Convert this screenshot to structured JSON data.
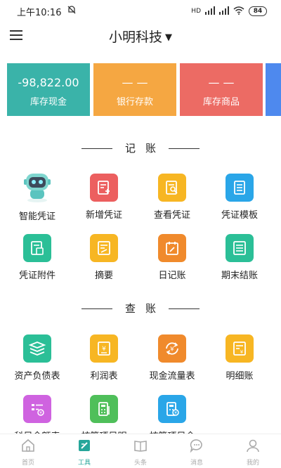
{
  "status": {
    "time": "上午10:16",
    "battery": "84",
    "network": "HD"
  },
  "header": {
    "company": "小明科技"
  },
  "cards": [
    {
      "value": "-98,822.00",
      "label": "库存现金"
    },
    {
      "value": "— —",
      "label": "银行存款"
    },
    {
      "value": "— —",
      "label": "库存商品"
    }
  ],
  "sections": {
    "bookkeeping": {
      "title": "记账",
      "items": [
        {
          "label": "智能凭证",
          "icon": "robot-icon"
        },
        {
          "label": "新增凭证",
          "icon": "add-voucher-icon"
        },
        {
          "label": "查看凭证",
          "icon": "view-voucher-icon"
        },
        {
          "label": "凭证模板",
          "icon": "voucher-template-icon"
        },
        {
          "label": "凭证附件",
          "icon": "attachment-icon"
        },
        {
          "label": "摘要",
          "icon": "summary-icon"
        },
        {
          "label": "日记账",
          "icon": "journal-icon"
        },
        {
          "label": "期末结账",
          "icon": "period-close-icon"
        }
      ]
    },
    "query": {
      "title": "查账",
      "items": [
        {
          "label": "资产负债表",
          "icon": "balance-sheet-icon"
        },
        {
          "label": "利润表",
          "icon": "income-statement-icon"
        },
        {
          "label": "现金流量表",
          "icon": "cash-flow-icon"
        },
        {
          "label": "明细账",
          "icon": "ledger-detail-icon"
        },
        {
          "label": "科目余额表",
          "icon": "account-balance-icon"
        },
        {
          "label": "核算项目明",
          "icon": "accounting-item-detail-icon"
        },
        {
          "label": "核算项目余",
          "icon": "accounting-item-balance-icon"
        }
      ]
    }
  },
  "tabs": [
    {
      "label": "首页",
      "icon": "home-icon"
    },
    {
      "label": "工具",
      "icon": "tools-icon"
    },
    {
      "label": "头条",
      "icon": "news-icon"
    },
    {
      "label": "消息",
      "icon": "message-icon"
    },
    {
      "label": "我的",
      "icon": "profile-icon"
    }
  ],
  "colors": {
    "teal": "#3ab3a9",
    "orange": "#f5a742",
    "red": "#ec6b64",
    "blue": "#4e89ee",
    "active_tab": "#26a69a"
  }
}
